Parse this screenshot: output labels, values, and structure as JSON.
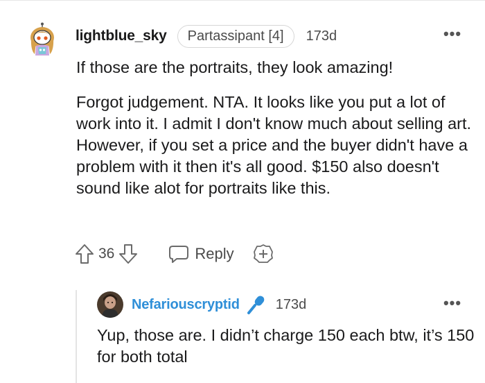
{
  "comment": {
    "username": "lightblue_sky",
    "flair": "Partassipant [4]",
    "timestamp": "173d",
    "more_label": "•••",
    "paragraphs": [
      "If those are the portraits, they look amazing!",
      "Forgot judgement. NTA. It looks like you put a lot of work into it. I admit I don't know much about selling art. However, if you set a price and the buyer didn't have a problem with it then it's all good. $150 also doesn't sound like alot for portraits like this."
    ],
    "actions": {
      "vote_count": "36",
      "reply_label": "Reply",
      "upvote_icon": "arrow-up-icon",
      "downvote_icon": "arrow-down-icon",
      "reply_icon": "speech-bubble-icon",
      "award_icon": "add-award-icon"
    }
  },
  "reply": {
    "username": "Nefariouscryptid",
    "timestamp": "173d",
    "more_label": "•••",
    "text": "Yup, those are. I didn’t charge 150 each btw, it’s 150 for both total",
    "badge_icon": "microphone-icon"
  },
  "colors": {
    "reply_username": "#2f8fd8",
    "muted_text": "#4a4a4a",
    "thread_line": "#e4e4e4",
    "flair_border": "#d6d6d6"
  }
}
